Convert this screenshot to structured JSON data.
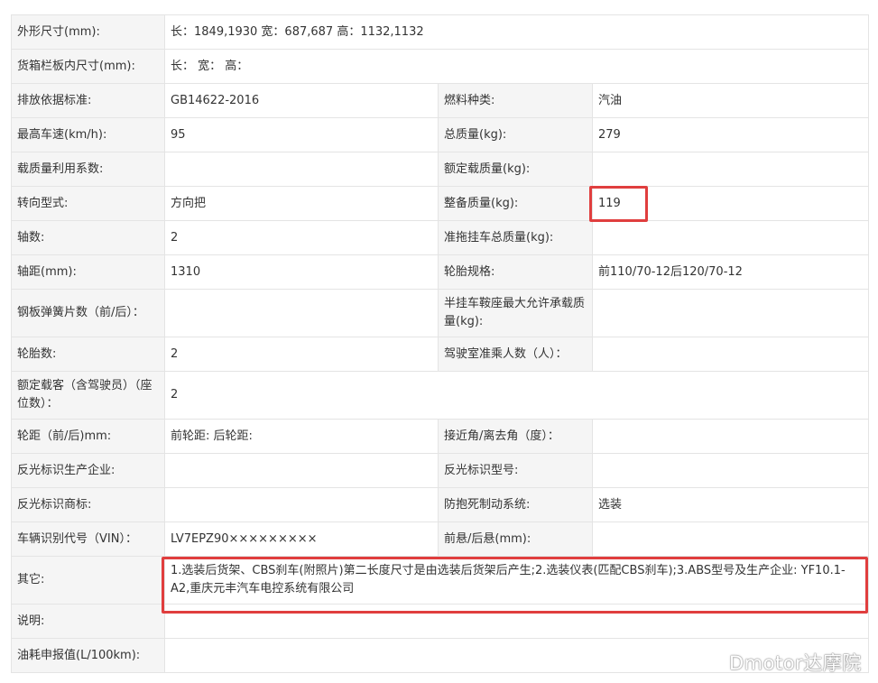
{
  "rows": [
    {
      "l1": "外形尺寸(mm):",
      "v1": "长：1849,1930 宽：687,687 高：1132,1132"
    },
    {
      "l1": "货箱栏板内尺寸(mm):",
      "v1": "长：  宽：  高："
    },
    {
      "l1": "排放依据标准:",
      "v1": "GB14622-2016",
      "l2": "燃料种类:",
      "v2": "汽油"
    },
    {
      "l1": "最高车速(km/h):",
      "v1": "95",
      "l2": "总质量(kg):",
      "v2": "279"
    },
    {
      "l1": "载质量利用系数:",
      "v1": "",
      "l2": "额定载质量(kg):",
      "v2": ""
    },
    {
      "l1": "转向型式:",
      "v1": "方向把",
      "l2": "整备质量(kg):",
      "v2": "119"
    },
    {
      "l1": "轴数:",
      "v1": "2",
      "l2": "准拖挂车总质量(kg):",
      "v2": ""
    },
    {
      "l1": "轴距(mm):",
      "v1": "1310",
      "l2": "轮胎规格:",
      "v2": "前110/70-12后120/70-12"
    },
    {
      "l1": "钢板弹簧片数（前/后）：",
      "v1": "",
      "l2": "半挂车鞍座最大允许承载质量(kg):",
      "v2": ""
    },
    {
      "l1": "轮胎数:",
      "v1": "2",
      "l2": "驾驶室准乘人数（人）：",
      "v2": ""
    },
    {
      "l1": "额定载客（含驾驶员）（座位数）：",
      "v1": "2"
    },
    {
      "l1": "轮距（前/后)mm:",
      "v1": "前轮距: 后轮距:",
      "l2": "接近角/离去角（度）：",
      "v2": ""
    },
    {
      "l1": "反光标识生产企业:",
      "v1": "",
      "l2": "反光标识型号:",
      "v2": ""
    },
    {
      "l1": "反光标识商标:",
      "v1": "",
      "l2": "防抱死制动系统:",
      "v2": "选装"
    },
    {
      "l1": "车辆识别代号（VIN）：",
      "v1": "LV7EPZ90×××××××××",
      "l2": "前悬/后悬(mm):",
      "v2": ""
    },
    {
      "l1": "其它:",
      "v1": "1.选装后货架、CBS刹车(附照片)第二长度尺寸是由选装后货架后产生;2.选装仪表(匹配CBS刹车);3.ABS型号及生产企业: YF10.1-A2,重庆元丰汽车电控系统有限公司"
    },
    {
      "l1": "说明:",
      "v1": ""
    },
    {
      "l1": "油耗申报值(L/100km):",
      "v1": ""
    }
  ],
  "watermark": "Dmotor达摩院",
  "colors": {
    "label_bg": "#f5f5f5",
    "border": "#e4e4e4",
    "highlight": "#e03e3e"
  }
}
